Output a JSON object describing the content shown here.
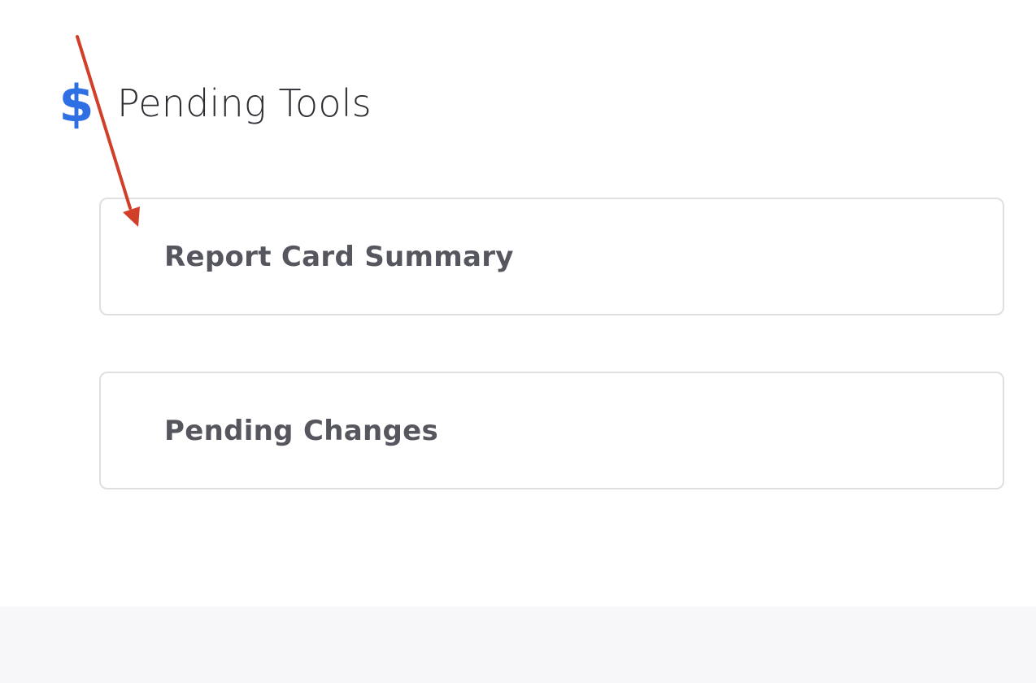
{
  "header": {
    "title": "Pending Tools",
    "icon": "dollar-icon",
    "icon_glyph": "$",
    "icon_color": "#2f6fe4"
  },
  "tools": [
    {
      "label": "Report Card Summary"
    },
    {
      "label": "Pending Changes"
    }
  ],
  "annotation": {
    "type": "arrow",
    "color": "#d13f28",
    "points_to": "Report Card Summary"
  }
}
